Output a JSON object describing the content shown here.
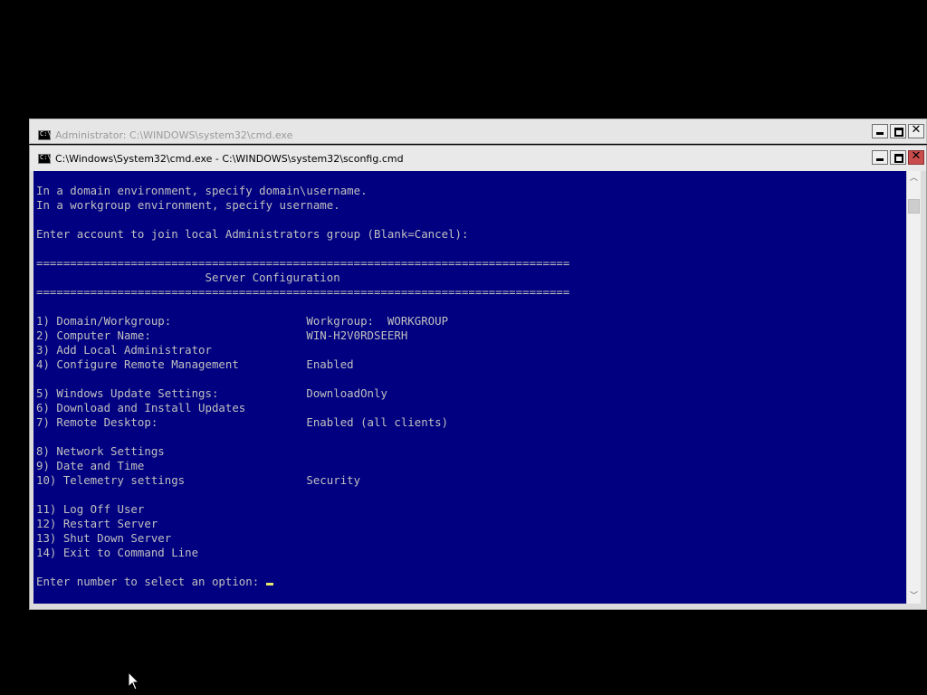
{
  "back_window": {
    "title": "Administrator: C:\\WINDOWS\\system32\\cmd.exe",
    "controls": {
      "minimize_icon": "minimize-icon",
      "maximize_icon": "maximize-icon",
      "close_icon": "close-icon",
      "close_glyph": "✕"
    }
  },
  "front_window": {
    "title": "C:\\Windows\\System32\\cmd.exe - C:\\WINDOWS\\system32\\sconfig.cmd",
    "controls": {
      "close_glyph": "✕",
      "close_color": "#c94c4c"
    },
    "console": {
      "bg_color": "#000080",
      "text_color": "#c0c0c0",
      "lines": [
        "In a domain environment, specify domain\\username.",
        "In a workgroup environment, specify username.",
        "",
        "Enter account to join local Administrators group (Blank=Cancel):",
        "",
        "===============================================================================",
        "                         Server Configuration",
        "===============================================================================",
        "",
        "1) Domain/Workgroup:                    Workgroup:  WORKGROUP",
        "2) Computer Name:                       WIN-H2V0RDSEERH",
        "3) Add Local Administrator",
        "4) Configure Remote Management          Enabled",
        "",
        "5) Windows Update Settings:             DownloadOnly",
        "6) Download and Install Updates",
        "7) Remote Desktop:                      Enabled (all clients)",
        "",
        "8) Network Settings",
        "9) Date and Time",
        "10) Telemetry settings                  Security",
        "",
        "11) Log Off User",
        "12) Restart Server",
        "13) Shut Down Server",
        "14) Exit to Command Line",
        ""
      ],
      "prompt": "Enter number to select an option: "
    },
    "scrollbar": {
      "up_glyph": "︿",
      "down_glyph": "﹀"
    }
  },
  "cursor_icon": "mouse-pointer-icon"
}
